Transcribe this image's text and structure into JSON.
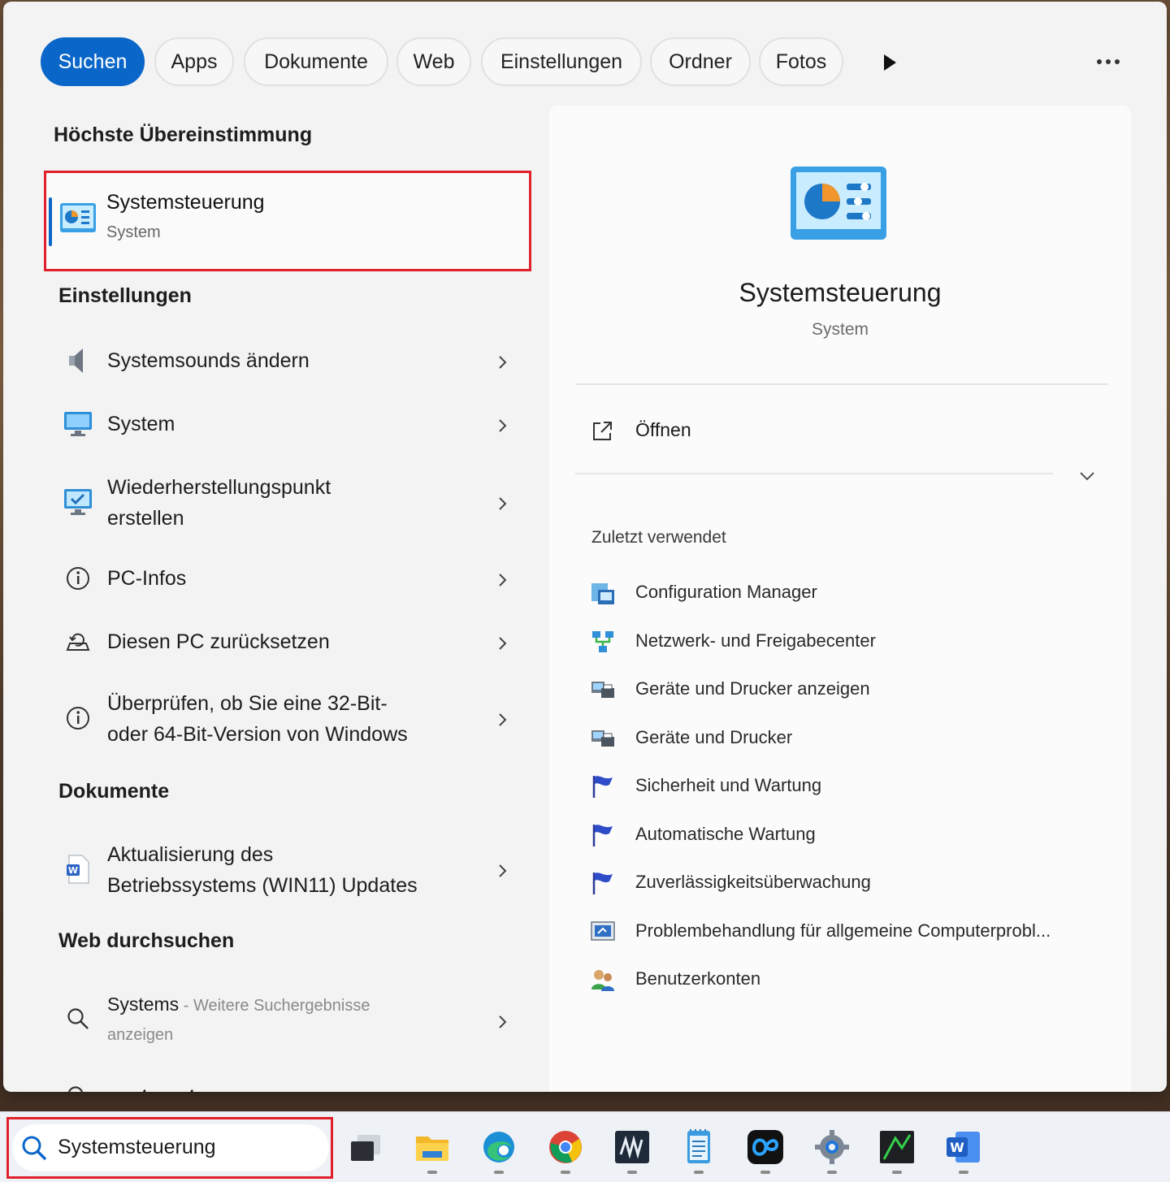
{
  "filters": {
    "items": [
      {
        "label": "Suchen",
        "active": true
      },
      {
        "label": "Apps"
      },
      {
        "label": "Dokumente"
      },
      {
        "label": "Web"
      },
      {
        "label": "Einstellungen"
      },
      {
        "label": "Ordner"
      },
      {
        "label": "Fotos"
      }
    ],
    "more_icon": "play-icon",
    "options_icon": "ellipsis-icon"
  },
  "best_match": {
    "section": "Höchste Übereinstimmung",
    "title": "Systemsteuerung",
    "subtitle": "System"
  },
  "settings": {
    "section": "Einstellungen",
    "items": [
      {
        "line1": "Systemsounds ändern"
      },
      {
        "line1": "System"
      },
      {
        "line1": "Wiederherstellungspunkt",
        "line2": "erstellen"
      },
      {
        "line1": "PC-Infos"
      },
      {
        "line1": "Diesen PC zurücksetzen"
      },
      {
        "line1": "Überprüfen, ob Sie eine 32-Bit-",
        "line2": "oder 64-Bit-Version von Windows"
      }
    ]
  },
  "documents": {
    "section": "Dokumente",
    "items": [
      {
        "line1": "Aktualisierung des",
        "line2": "Betriebssystems (WIN11) Updates"
      }
    ]
  },
  "web": {
    "section": "Web durchsuchen",
    "items": [
      {
        "query": "Systems",
        "hint": " - Weitere Suchergebnisse",
        "hint2": "anzeigen"
      },
      {
        "query": "systemsteuerung"
      }
    ]
  },
  "preview": {
    "title": "Systemsteuerung",
    "subtitle": "System",
    "open_label": "Öffnen",
    "recent_title": "Zuletzt verwendet",
    "recent": [
      "Configuration Manager",
      "Netzwerk- und Freigabecenter",
      "Geräte und Drucker anzeigen",
      "Geräte und Drucker",
      "Sicherheit und Wartung",
      "Automatische Wartung",
      "Zuverlässigkeitsüberwachung",
      "Problembehandlung für allgemeine Computerprobl...",
      "Benutzerkonten"
    ]
  },
  "taskbar": {
    "search_value": "Systemsteuerung",
    "apps": [
      "task-view",
      "file-explorer",
      "edge",
      "chrome",
      "terminal",
      "notepad",
      "copilot",
      "settings",
      "app",
      "word"
    ]
  },
  "colors": {
    "accent": "#0a66c8",
    "highlight": "#e0202a"
  }
}
